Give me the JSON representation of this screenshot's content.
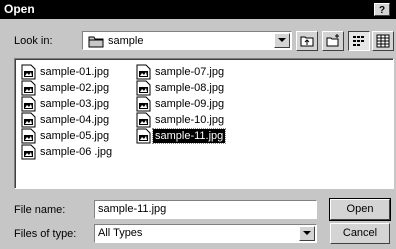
{
  "window": {
    "title": "Open",
    "help_label": "?"
  },
  "lookin": {
    "label": "Look in:",
    "folder_icon": "folder-icon",
    "value": "sample"
  },
  "toolbar": [
    {
      "name": "up-one-level-button",
      "icon": "up-folder-icon"
    },
    {
      "name": "new-folder-button",
      "icon": "new-folder-icon"
    },
    {
      "name": "list-view-button",
      "icon": "list-view-icon",
      "pressed": true
    },
    {
      "name": "details-view-button",
      "icon": "details-view-icon",
      "pressed": false
    }
  ],
  "files": [
    {
      "label": "sample-01.jpg",
      "icon": "image-file-icon"
    },
    {
      "label": "sample-02.jpg",
      "icon": "image-file-icon"
    },
    {
      "label": "sample-03.jpg",
      "icon": "image-file-icon"
    },
    {
      "label": "sample-04.jpg",
      "icon": "image-file-icon"
    },
    {
      "label": "sample-05.jpg",
      "icon": "image-file-icon"
    },
    {
      "label": "sample-06 .jpg",
      "icon": "image-file-icon"
    },
    {
      "label": "sample-07.jpg",
      "icon": "image-file-icon"
    },
    {
      "label": "sample-08.jpg",
      "icon": "image-file-icon"
    },
    {
      "label": "sample-09.jpg",
      "icon": "image-file-icon"
    },
    {
      "label": "sample-10.jpg",
      "icon": "image-file-icon"
    },
    {
      "label": "sample-11.jpg",
      "icon": "image-file-icon",
      "selected": true
    }
  ],
  "filename": {
    "label": "File name:",
    "value": "sample-11.jpg"
  },
  "filetype": {
    "label": "Files of type:",
    "value": "All Types"
  },
  "buttons": {
    "open": "Open",
    "cancel": "Cancel"
  },
  "colors": {
    "face": "#c6c6c6",
    "titlebar": "#000000",
    "selection": "#000000"
  }
}
